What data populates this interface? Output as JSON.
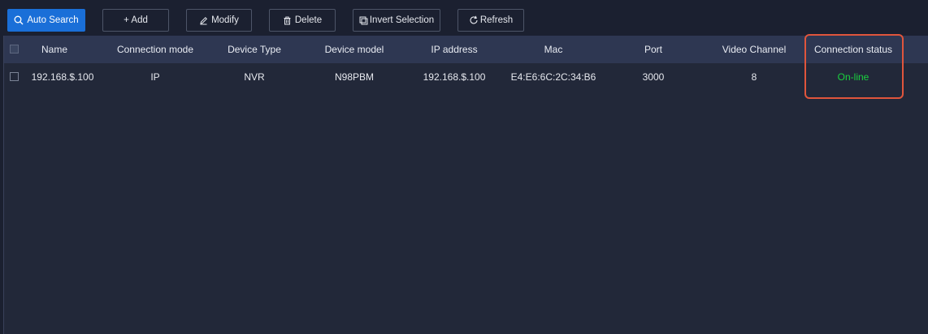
{
  "toolbar": {
    "auto_search_label": "Auto Search",
    "add_label": "+ Add",
    "modify_label": "Modify",
    "delete_label": "Delete",
    "invert_selection_label": "Invert Selection",
    "refresh_label": "Refresh"
  },
  "table": {
    "columns": [
      "Name",
      "Connection mode",
      "Device Type",
      "Device model",
      "IP address",
      "Mac",
      "Port",
      "Video Channel",
      "Connection status"
    ],
    "rows": [
      {
        "name": "192.168.$.100",
        "connection_mode": "IP",
        "device_type": "NVR",
        "device_model": "N98PBM",
        "ip_address": "192.168.$.100",
        "mac": "E4:E6:6C:2C:34:B6",
        "port": "3000",
        "video_channel": "8",
        "connection_status": "On-line"
      }
    ]
  },
  "colors": {
    "accent": "#1a6fd8",
    "status_online": "#19d13e",
    "highlight": "#e0553c"
  }
}
